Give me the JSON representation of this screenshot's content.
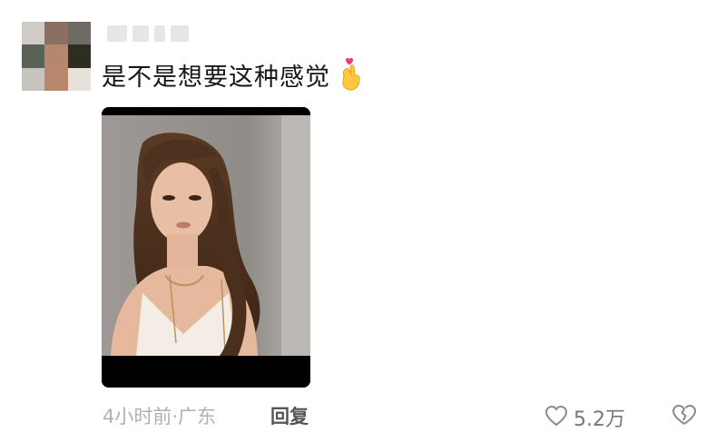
{
  "comment": {
    "username_blurred": "",
    "text": "是不是想要这种感觉",
    "emoji": "finger-heart-icon",
    "meta": "4小时前·广东",
    "reply_label": "回复",
    "like_count": "5.2万"
  },
  "colors": {
    "text_primary": "#161616",
    "text_secondary": "#b0b0b0",
    "reply": "#555555",
    "icon": "#8a8a8a"
  }
}
